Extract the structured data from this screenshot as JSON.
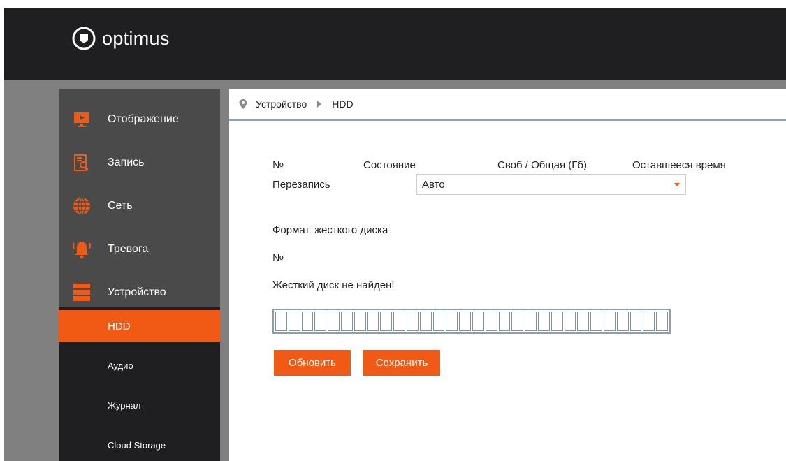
{
  "app": {
    "brand": "optimus"
  },
  "colors": {
    "accent": "#f05a14",
    "topbar": "#1f1f21",
    "sidebar": "#4a4a4a",
    "submenu": "#1f1f21"
  },
  "sidebar": {
    "items": [
      {
        "label": "Отображение",
        "icon": "monitor-icon"
      },
      {
        "label": "Запись",
        "icon": "record-search-icon"
      },
      {
        "label": "Сеть",
        "icon": "globe-icon"
      },
      {
        "label": "Тревога",
        "icon": "alarm-bell-icon"
      },
      {
        "label": "Устройство",
        "icon": "server-icon"
      }
    ],
    "subitems": [
      {
        "label": "HDD",
        "active": true
      },
      {
        "label": "Аудио",
        "active": false
      },
      {
        "label": "Журнал",
        "active": false
      },
      {
        "label": "Cloud Storage",
        "active": false
      }
    ]
  },
  "breadcrumb": {
    "parent": "Устройство",
    "current": "HDD"
  },
  "main": {
    "table_headers": [
      "№",
      "Состояние",
      "Своб / Общая (Гб)",
      "Оставшееся время"
    ],
    "overwrite_label": "Перезапись",
    "overwrite_value": "Авто",
    "format_label": "Формат. жесткого диска",
    "number_label": "№",
    "status_message": "Жесткий диск не найден!",
    "refresh_button": "Обновить",
    "save_button": "Сохранить"
  }
}
